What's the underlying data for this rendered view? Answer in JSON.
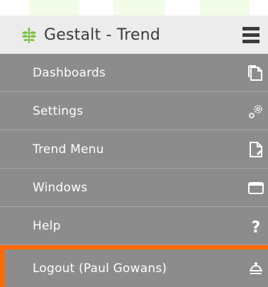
{
  "app": {
    "title": "Gestalt - Trend"
  },
  "menu": {
    "items": [
      {
        "label": "Dashboards",
        "icon": "dashboards-icon"
      },
      {
        "label": "Settings",
        "icon": "settings-icon"
      },
      {
        "label": "Trend Menu",
        "icon": "trend-menu-icon"
      },
      {
        "label": "Windows",
        "icon": "windows-icon"
      },
      {
        "label": "Help",
        "icon": "help-icon"
      },
      {
        "label": "Logout (Paul Gowans)",
        "icon": "logout-icon"
      }
    ],
    "selected_index": 5
  },
  "colors": {
    "header_bg": "#ececec",
    "menu_bg": "#8c8c8c",
    "accent": "#ff6a00",
    "logo_green": "#7cc242",
    "text_dark": "#3b3b3b"
  }
}
